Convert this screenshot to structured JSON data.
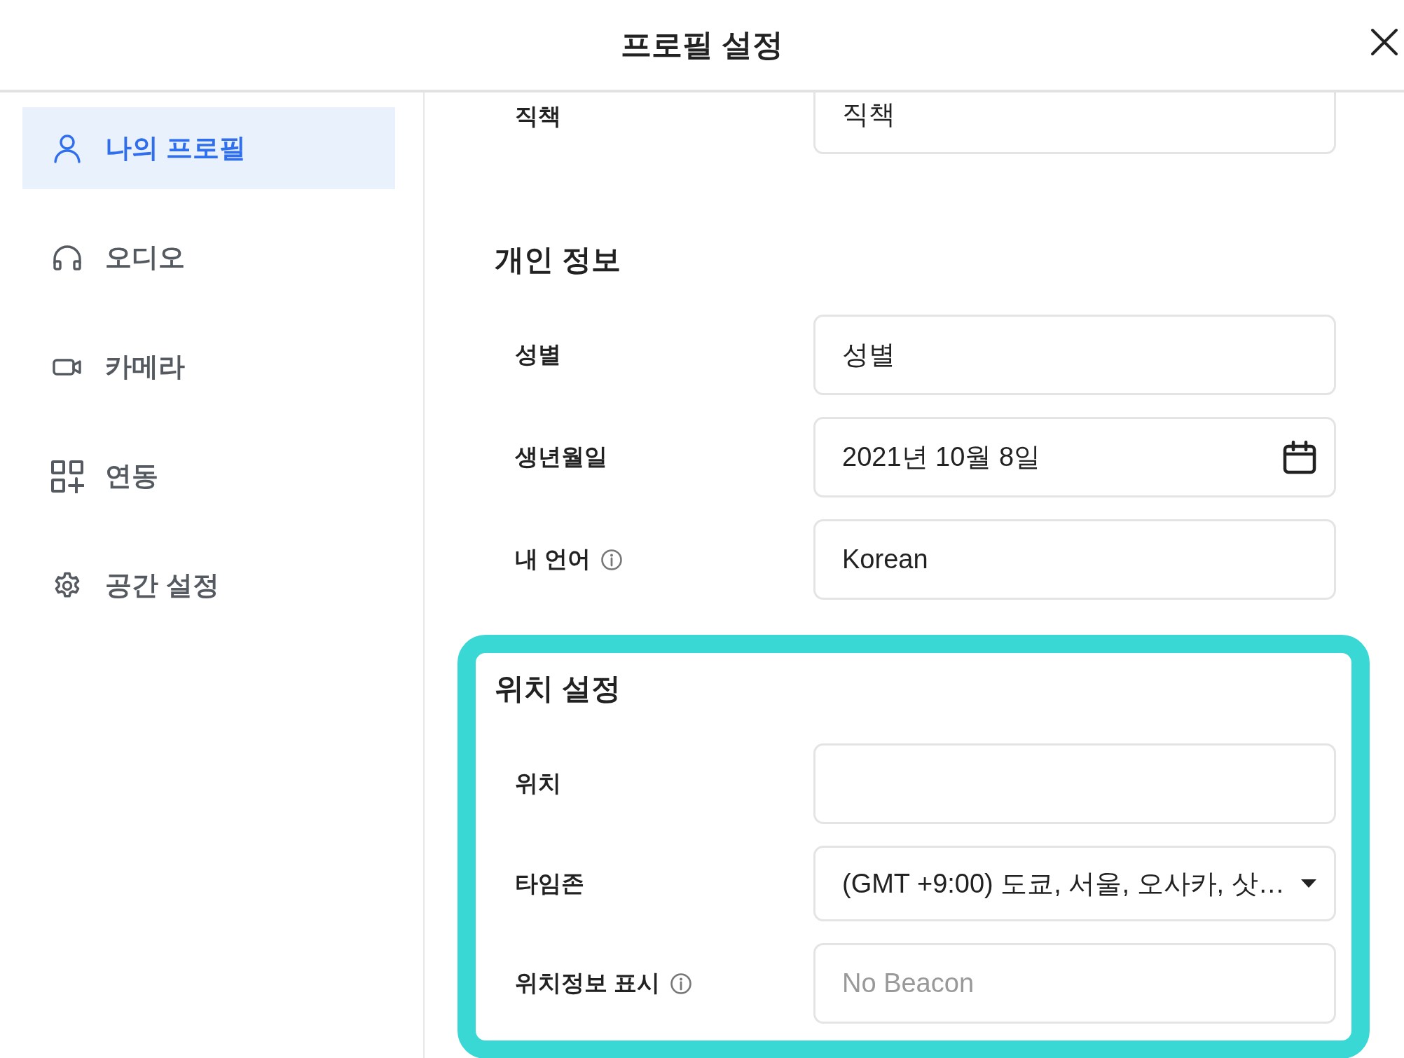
{
  "dialog": {
    "title": "프로필 설정"
  },
  "sidebar": {
    "items": [
      {
        "label": "나의 프로필",
        "kind": "person",
        "selected": true
      },
      {
        "label": "오디오",
        "kind": "headphones",
        "selected": false
      },
      {
        "label": "카메라",
        "kind": "camera",
        "selected": false
      },
      {
        "label": "연동",
        "kind": "apps",
        "selected": false
      },
      {
        "label": "공간 설정",
        "kind": "gear",
        "selected": false
      }
    ]
  },
  "sections": [
    {
      "highlighted": false,
      "fields": [
        {
          "label": "직책",
          "kind": "text",
          "value": "직책",
          "info": false
        }
      ]
    },
    {
      "heading": "개인 정보",
      "highlighted": false,
      "fields": [
        {
          "label": "성별",
          "kind": "text",
          "value": "성별",
          "info": false
        },
        {
          "label": "생년월일",
          "kind": "date",
          "value": "2021년 10월 8일",
          "info": false
        },
        {
          "label": "내 언어",
          "kind": "text",
          "value": "Korean",
          "info": true
        }
      ]
    },
    {
      "heading": "위치 설정",
      "highlighted": true,
      "fields": [
        {
          "label": "위치",
          "kind": "text",
          "info": false
        },
        {
          "label": "타임존",
          "kind": "select",
          "value": "(GMT +9:00) 도쿄, 서울, 오사카, 삿…",
          "info": false
        },
        {
          "label": "위치정보 표시",
          "kind": "text",
          "placeholder": "No Beacon",
          "info": true
        }
      ]
    }
  ]
}
